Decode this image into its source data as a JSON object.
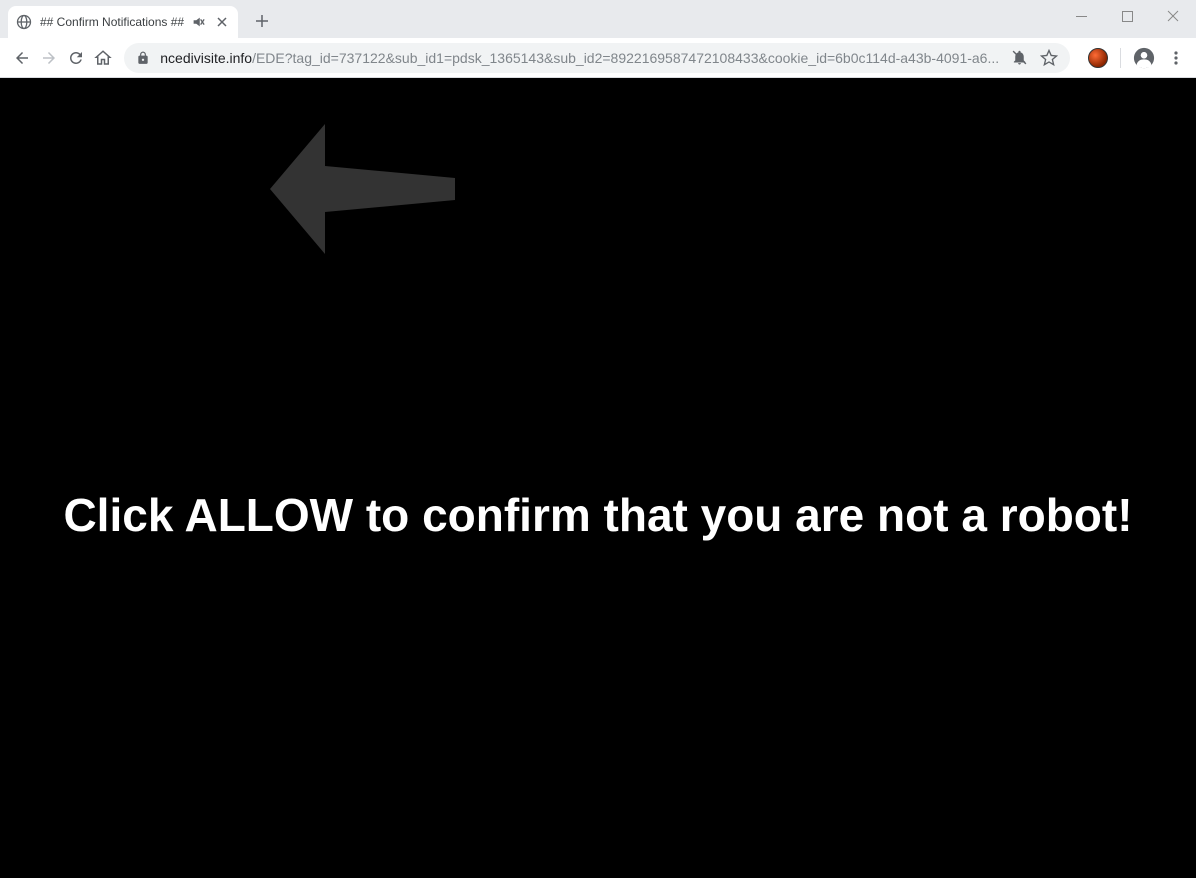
{
  "window": {
    "tab_title": "## Confirm Notifications ##"
  },
  "address_bar": {
    "domain": "ncedivisite.info",
    "path": "/EDE?tag_id=737122&sub_id1=pdsk_1365143&sub_id2=8922169587472108433&cookie_id=6b0c114d-a43b-4091-a6..."
  },
  "page": {
    "main_text": "Click ALLOW to confirm that you are not a robot!"
  }
}
